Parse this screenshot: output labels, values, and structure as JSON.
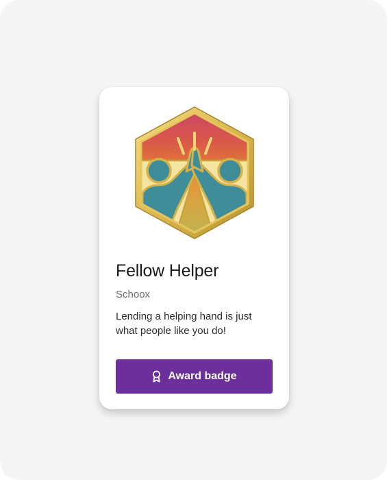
{
  "badge": {
    "image": "fellow-helper-badge-high-five",
    "title": "Fellow Helper",
    "issuer": "Schoox",
    "description": "Lending a helping hand is just what people like you do!"
  },
  "actions": {
    "award_label": "Award badge",
    "award_icon": "award-ribbon-icon",
    "button_color": "#6c2f9c"
  }
}
